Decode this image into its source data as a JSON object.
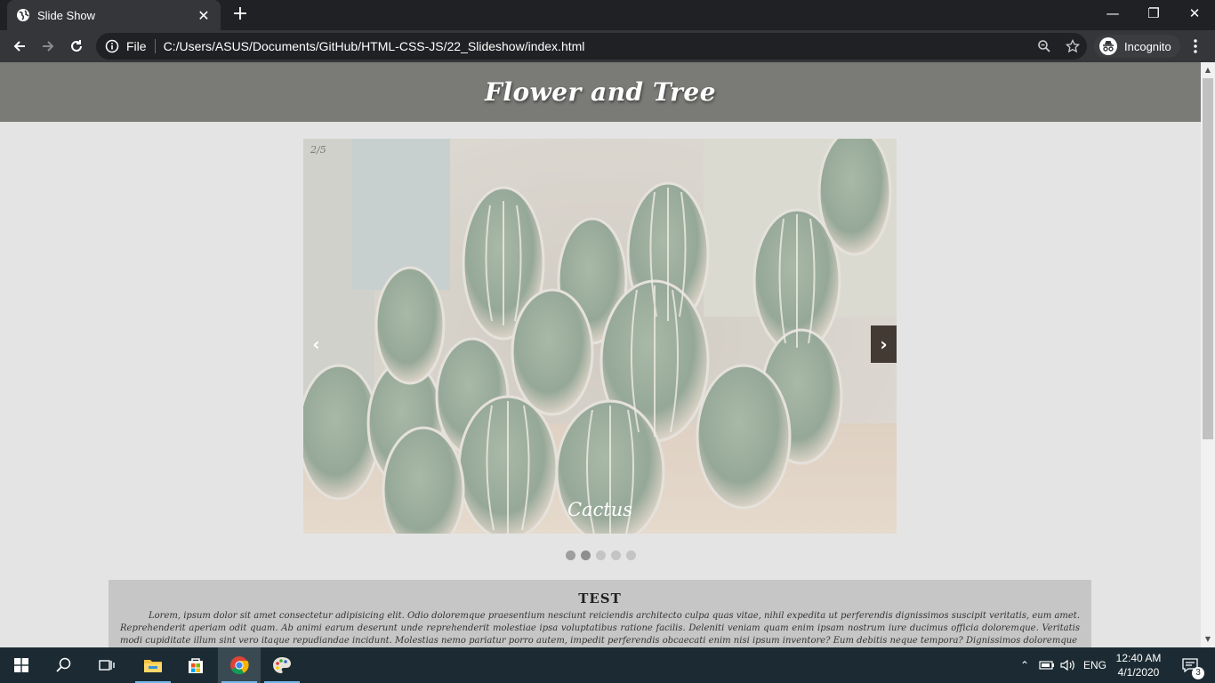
{
  "browser": {
    "tab_title": "Slide Show",
    "tab_close": "✕",
    "new_tab": "+",
    "omnibox_scheme": "File",
    "url": "C:/Users/ASUS/Documents/GitHub/HTML-CSS-JS/22_Slideshow/index.html",
    "incognito_label": "Incognito",
    "window_minimize": "—",
    "window_restore": "❐",
    "window_close": "✕"
  },
  "page": {
    "title": "Flower and Tree",
    "slideshow": {
      "counter": "2/5",
      "caption": "Cactus",
      "prev": "‹",
      "next": "›",
      "total_slides": 5,
      "current_slide": 2
    },
    "article": {
      "title": "TEST",
      "body": "Lorem, ipsum dolor sit amet consectetur adipisicing elit. Odio doloremque praesentium nesciunt reiciendis architecto culpa quas vitae, nihil expedita ut perferendis dignissimos suscipit veritatis, eum amet. Reprehenderit aperiam odit quam. Ab animi earum deserunt unde reprehenderit molestiae ipsa voluptatibus ratione facilis. Deleniti veniam quam enim ipsam nostrum iure ducimus officia doloremque. Veritatis modi cupiditate illum sint vero itaque repudiandae incidunt. Molestias nemo pariatur porro autem, impedit perferendis obcaecati enim nisi ipsum inventore? Eum debitis neque tempora? Dignissimos doloremque"
    }
  },
  "taskbar": {
    "language": "ENG",
    "time": "12:40 AM",
    "date": "4/1/2020",
    "notifications": "3"
  },
  "colors": {
    "header_bg": "#7a7a77",
    "page_bg": "#e4e4e4",
    "article_bg": "#c6c6c6",
    "chrome_dark": "#202124",
    "chrome_toolbar": "#35363a",
    "taskbar_bg": "#1c2b33"
  }
}
